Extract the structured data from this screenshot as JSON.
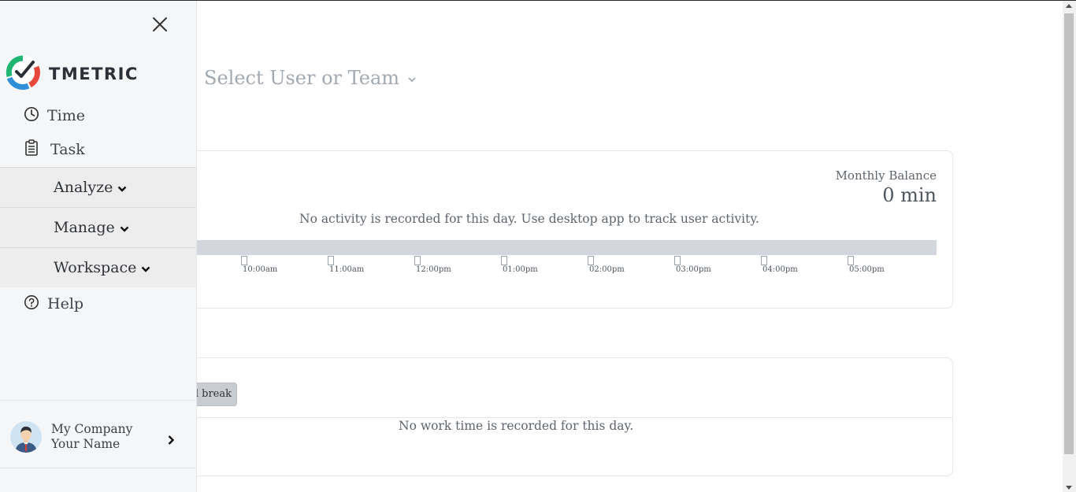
{
  "header": {
    "user_select_label": "Select User or Team"
  },
  "activity_card": {
    "balance_label": "Monthly Balance",
    "balance_value": "0 min",
    "empty_message": "No activity is recorded for this day. Use desktop app to track user activity.",
    "time_labels": [
      "10:00am",
      "11:00am",
      "12:00pm",
      "01:00pm",
      "02:00pm",
      "03:00pm",
      "04:00pm",
      "05:00pm"
    ]
  },
  "work_card": {
    "break_button_label": "d break",
    "empty_message": "No work time is recorded for this day."
  },
  "sidebar": {
    "logo_text": "TMETRIC",
    "items": [
      {
        "label": "Time",
        "icon": "clock-icon"
      },
      {
        "label": "Task",
        "icon": "clipboard-icon"
      }
    ],
    "groups": [
      {
        "label": "Analyze"
      },
      {
        "label": "Manage"
      },
      {
        "label": "Workspace"
      }
    ],
    "help": {
      "label": "Help",
      "icon": "question-circle-icon"
    },
    "profile": {
      "company": "My Company",
      "name": "Your Name"
    }
  },
  "colors": {
    "sidebar_bg": "#f5f6f8",
    "group_bg": "#ededed",
    "timeline_bar": "#d3d6dd",
    "logo_green": "#21b573",
    "logo_red": "#e8473b",
    "logo_blue": "#2f8fd8"
  }
}
